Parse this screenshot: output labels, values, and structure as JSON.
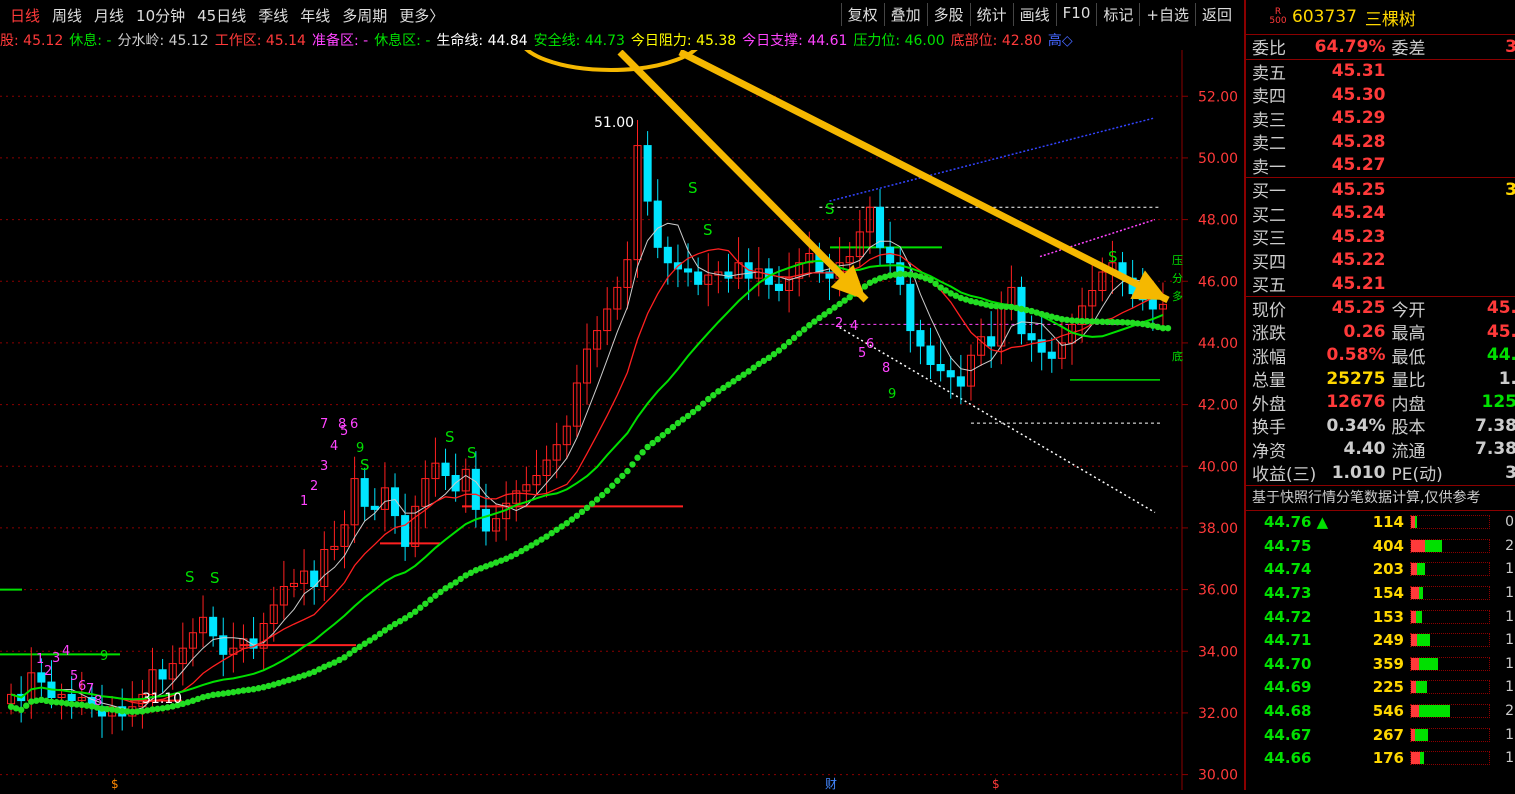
{
  "topbar": {
    "tabs": [
      "日线",
      "周线",
      "月线",
      "10分钟",
      "45日线",
      "季线",
      "年线",
      "多周期",
      "更多〉"
    ],
    "tools": [
      "复权",
      "叠加",
      "多股",
      "统计",
      "画线",
      "F10",
      "标记",
      "+自选",
      "返回"
    ]
  },
  "indicators": [
    {
      "label": "股: 45.12",
      "color": "#ff3a3a"
    },
    {
      "label": "休息: -",
      "color": "#00e000"
    },
    {
      "label": "分水岭: 45.12",
      "color": "#cccccc"
    },
    {
      "label": "工作区: 45.14",
      "color": "#ff3a3a"
    },
    {
      "label": "准备区: -",
      "color": "#ff44ff"
    },
    {
      "label": "休息区: -",
      "color": "#00e000"
    },
    {
      "label": "生命线: 44.84",
      "color": "#ffffff"
    },
    {
      "label": "安全线: 44.73",
      "color": "#00e000"
    },
    {
      "label": "今日阻力: 45.38",
      "color": "#ffff00"
    },
    {
      "label": "今日支撑: 44.61",
      "color": "#ff44ff"
    },
    {
      "label": "压力位: 46.00",
      "color": "#00e000"
    },
    {
      "label": "底部位: 42.80",
      "color": "#ff3a3a"
    },
    {
      "label": "高◇",
      "color": "#4466ff"
    }
  ],
  "chart_data": {
    "type": "candlestick",
    "y_ticks": [
      "52.00",
      "50.00",
      "48.00",
      "46.00",
      "44.00",
      "42.00",
      "40.00",
      "38.00",
      "36.00",
      "34.00",
      "32.00",
      "30.00"
    ],
    "ylim": [
      29.5,
      53.5
    ],
    "high_label": "51.00",
    "low_label": "31.10",
    "count_labels_early": [
      "1",
      "2",
      "3",
      "4",
      "5",
      "6",
      "7",
      "8",
      "9"
    ],
    "count_labels_mid": [
      "1",
      "2",
      "3",
      "4",
      "5",
      "6",
      "7",
      "8",
      "9"
    ],
    "count_labels_late": [
      "2",
      "4",
      "5",
      "6",
      "8",
      "9"
    ],
    "signal_label": "S",
    "event_markers": [
      "$",
      "财",
      "$"
    ],
    "right_tags": [
      "压",
      "分",
      "多",
      "底"
    ],
    "candles": [
      32.6,
      32.4,
      33.3,
      33.0,
      32.5,
      32.6,
      32.4,
      32.5,
      32.2,
      31.9,
      32.2,
      31.9,
      32.2,
      32.6,
      33.4,
      33.1,
      33.6,
      34.1,
      34.6,
      35.1,
      34.5,
      33.9,
      34.1,
      34.4,
      34.1,
      34.9,
      35.5,
      36.1,
      36.2,
      36.6,
      36.1,
      37.3,
      37.4,
      38.1,
      39.6,
      38.7,
      38.6,
      39.3,
      38.4,
      37.4,
      38.7,
      39.6,
      40.1,
      39.7,
      39.2,
      39.9,
      38.6,
      37.9,
      38.3,
      38.8,
      39.2,
      39.4,
      39.7,
      40.2,
      40.7,
      41.3,
      42.7,
      43.8,
      44.4,
      45.1,
      45.8,
      46.7,
      50.4,
      48.6,
      47.1,
      46.6,
      46.4,
      46.3,
      45.9,
      46.2,
      46.3,
      46.1,
      46.6,
      46.1,
      46.4,
      45.9,
      45.7,
      46.1,
      46.6,
      46.9,
      46.3,
      46.1,
      46.6,
      46.8,
      47.6,
      48.4,
      47.1,
      46.6,
      45.9,
      44.4,
      43.9,
      43.3,
      43.1,
      42.9,
      42.6,
      43.6,
      44.2,
      43.9,
      45.2,
      45.8,
      44.3,
      44.1,
      43.7,
      43.5,
      44.0,
      44.6,
      45.2,
      45.7,
      46.3,
      46.6,
      46.1,
      45.6,
      45.4,
      45.1,
      45.25
    ]
  },
  "quote": {
    "rank": "R",
    "rank_num": "500",
    "code": "603737",
    "name": "三棵树",
    "webi": {
      "label1": "委比",
      "value1": "64.79%",
      "label2": "委差",
      "value2": "3"
    },
    "sells": [
      {
        "label": "卖五",
        "price": "45.31"
      },
      {
        "label": "卖四",
        "price": "45.30"
      },
      {
        "label": "卖三",
        "price": "45.29"
      },
      {
        "label": "卖二",
        "price": "45.28"
      },
      {
        "label": "卖一",
        "price": "45.27"
      }
    ],
    "buys": [
      {
        "label": "买一",
        "price": "45.25",
        "vol": "3"
      },
      {
        "label": "买二",
        "price": "45.24",
        "vol": ""
      },
      {
        "label": "买三",
        "price": "45.23",
        "vol": ""
      },
      {
        "label": "买四",
        "price": "45.22",
        "vol": ""
      },
      {
        "label": "买五",
        "price": "45.21",
        "vol": ""
      }
    ],
    "stats": [
      {
        "l1": "现价",
        "v1": "45.25",
        "c1": "#ff3a3a",
        "l2": "今开",
        "v2": "45.",
        "c2": "#ff3a3a"
      },
      {
        "l1": "涨跌",
        "v1": "0.26",
        "c1": "#ff3a3a",
        "l2": "最高",
        "v2": "45.",
        "c2": "#ff3a3a"
      },
      {
        "l1": "涨幅",
        "v1": "0.58%",
        "c1": "#ff3a3a",
        "l2": "最低",
        "v2": "44.",
        "c2": "#00e000"
      },
      {
        "l1": "总量",
        "v1": "25275",
        "c1": "#ffd700",
        "l2": "量比",
        "v2": "1.",
        "c2": "#cccccc"
      },
      {
        "l1": "外盘",
        "v1": "12676",
        "c1": "#ff3a3a",
        "l2": "内盘",
        "v2": "125",
        "c2": "#00e000"
      },
      {
        "l1": "换手",
        "v1": "0.34%",
        "c1": "#cccccc",
        "l2": "股本",
        "v2": "7.38",
        "c2": "#cccccc"
      },
      {
        "l1": "净资",
        "v1": "4.40",
        "c1": "#cccccc",
        "l2": "流通",
        "v2": "7.38",
        "c2": "#cccccc"
      },
      {
        "l1": "收益(三)",
        "v1": "1.010",
        "c1": "#cccccc",
        "l2": "PE(动)",
        "v2": "3",
        "c2": "#cccccc"
      }
    ],
    "note": "基于快照行情分笔数据计算,仅供参考",
    "ticks": [
      {
        "price": "44.76",
        "vol": "114",
        "red": 0.05,
        "green": 0.03,
        "cnt": "0",
        "up": true
      },
      {
        "price": "44.75",
        "vol": "404",
        "red": 0.18,
        "green": 0.22,
        "cnt": "2",
        "up": false
      },
      {
        "price": "44.74",
        "vol": "203",
        "red": 0.08,
        "green": 0.1,
        "cnt": "1",
        "up": false
      },
      {
        "price": "44.73",
        "vol": "154",
        "red": 0.1,
        "green": 0.05,
        "cnt": "1",
        "up": false
      },
      {
        "price": "44.72",
        "vol": "153",
        "red": 0.06,
        "green": 0.08,
        "cnt": "1",
        "up": false
      },
      {
        "price": "44.71",
        "vol": "249",
        "red": 0.08,
        "green": 0.16,
        "cnt": "1",
        "up": false
      },
      {
        "price": "44.70",
        "vol": "359",
        "red": 0.1,
        "green": 0.24,
        "cnt": "1",
        "up": false
      },
      {
        "price": "44.69",
        "vol": "225",
        "red": 0.07,
        "green": 0.14,
        "cnt": "1",
        "up": false
      },
      {
        "price": "44.68",
        "vol": "546",
        "red": 0.1,
        "green": 0.4,
        "cnt": "2",
        "up": false
      },
      {
        "price": "44.67",
        "vol": "267",
        "red": 0.05,
        "green": 0.17,
        "cnt": "1",
        "up": false
      },
      {
        "price": "44.66",
        "vol": "176",
        "red": 0.12,
        "green": 0.05,
        "cnt": "1",
        "up": false
      }
    ]
  }
}
